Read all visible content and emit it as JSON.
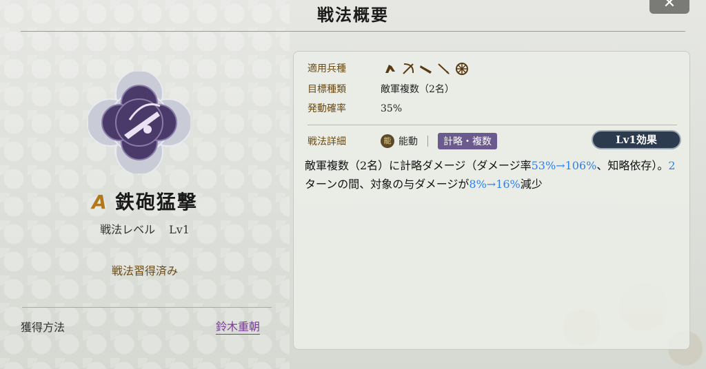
{
  "title": "戦法概要",
  "close_label": "✕",
  "tactic": {
    "grade": "A",
    "name": "鉄砲猛撃",
    "level_label": "戦法レベル",
    "level_value": "Lv1",
    "learned_status": "戦法習得済み",
    "acquire_label": "獲得方法",
    "acquire_source": "鈴木重朝"
  },
  "info": {
    "unit_types_label": "適用兵種",
    "unit_type_icons": [
      "cavalry-icon",
      "bow-icon",
      "gun-icon",
      "spear-icon",
      "wheel-icon"
    ],
    "target_label": "目標種類",
    "target_value": "敵軍複数（2名）",
    "chance_label": "発動確率",
    "chance_value": "35%",
    "detail_label": "戦法詳細",
    "active_icon_glyph": "能",
    "active_label": "能動",
    "tag_label": "計略・複数",
    "effect_button": "Lv1効果"
  },
  "description": {
    "p1": "敵軍複数（2名）に計略ダメージ（ダメージ率",
    "hl1": "53%→106%",
    "p2": "、知略依存）。",
    "hl2": "2",
    "p3": "ターンの間、対象の与ダメージが",
    "hl3": "8%→16%",
    "p4": "減少"
  },
  "colors": {
    "highlight": "#2d7ff0",
    "label_brown": "#6a4a14",
    "tag_purple": "#6a5a8e",
    "emblem_purple": "#4a3a6a"
  }
}
